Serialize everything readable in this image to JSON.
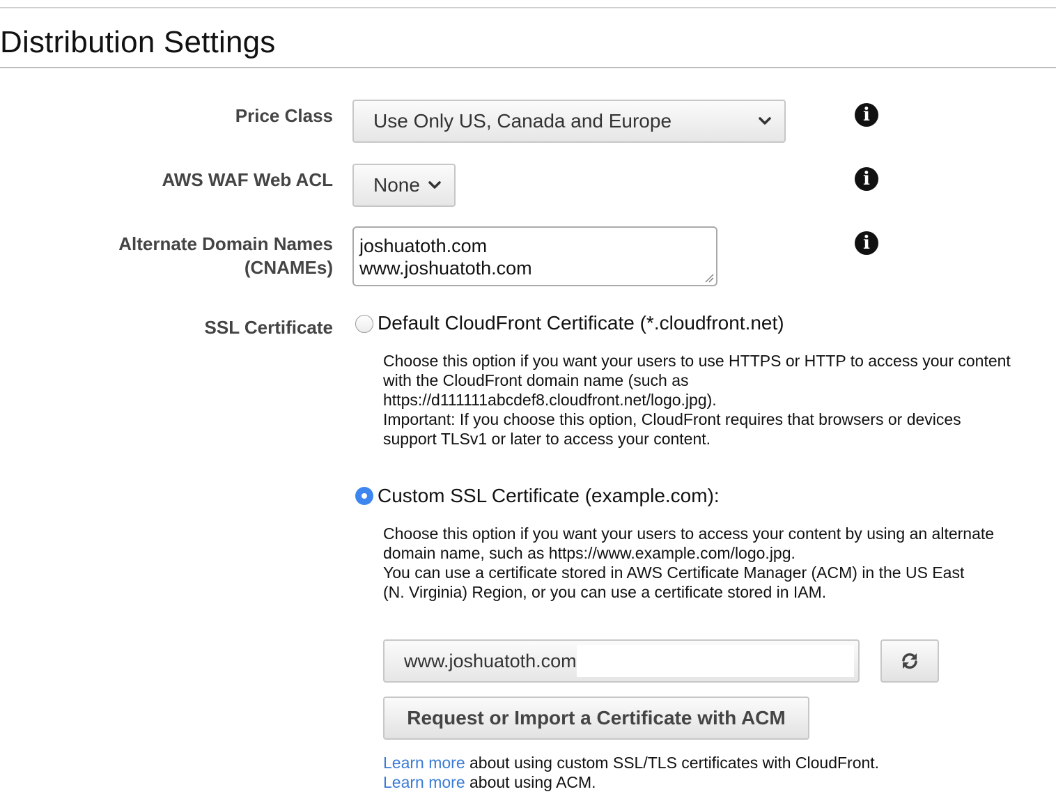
{
  "section": {
    "title": "Distribution Settings"
  },
  "fields": {
    "price_class": {
      "label": "Price Class",
      "value": "Use Only US, Canada and Europe"
    },
    "waf": {
      "label": "AWS WAF Web ACL",
      "value": "None"
    },
    "cnames": {
      "label_line1": "Alternate Domain Names",
      "label_line2": "(CNAMEs)",
      "line1": "joshuatoth.com",
      "line2": "www.joshuatoth.com"
    },
    "ssl": {
      "label": "SSL Certificate",
      "default_option": {
        "label": "Default CloudFront Certificate (*.cloudfront.net)",
        "checked": false,
        "desc_line1": "Choose this option if you want your users to use HTTPS or HTTP to access your content",
        "desc_line2": "with the CloudFront domain name (such as",
        "desc_line3": "https://d111111abcdef8.cloudfront.net/logo.jpg).",
        "desc_line4": "Important: If you choose this option, CloudFront requires that browsers or devices",
        "desc_line5": "support TLSv1 or later to access your content."
      },
      "custom_option": {
        "label": "Custom SSL Certificate (example.com):",
        "checked": true,
        "desc_line1": "Choose this option if you want your users to access your content by using an alternate",
        "desc_line2": "domain name, such as https://www.example.com/logo.jpg.",
        "desc_line3": "You can use a certificate stored in AWS Certificate Manager (ACM) in the US East",
        "desc_line4": "(N. Virginia) Region, or you can use a certificate stored in IAM."
      },
      "certificate_value": "www.joshuatoth.com",
      "request_button": "Request or Import a Certificate with ACM",
      "help": [
        {
          "link": "Learn more",
          "text": " about using custom SSL/TLS certificates with CloudFront."
        },
        {
          "link": "Learn more",
          "text": " about using ACM."
        }
      ]
    }
  },
  "icons": {
    "info": "info-icon",
    "dropdown": "chevron-down-icon",
    "refresh": "refresh-icon"
  },
  "colors": {
    "link": "#3a7bd5",
    "radio_selected": "#3d86f0"
  }
}
